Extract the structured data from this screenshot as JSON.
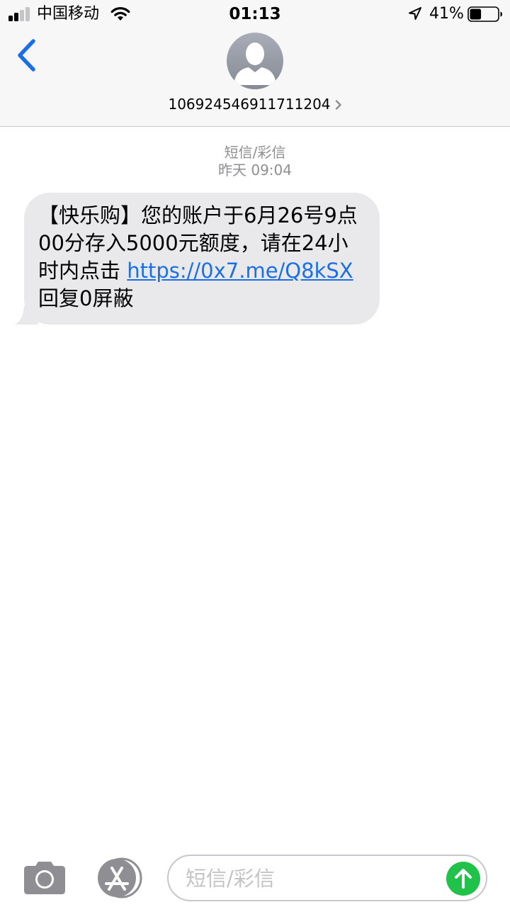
{
  "status_bar": {
    "carrier": "中国移动",
    "time": "01:13",
    "battery_percent": "41%",
    "battery_level": 0.41,
    "signal_bars_filled": 2,
    "signal_bars_total": 4,
    "icons": [
      "signal-icon",
      "wifi-icon",
      "location-arrow-icon",
      "battery-icon"
    ]
  },
  "header": {
    "back_icon": "chevron-left-icon",
    "avatar_icon": "person-silhouette-icon",
    "contact_number": "106924546911711204",
    "contact_chevron": "chevron-right-icon"
  },
  "conversation": {
    "service_label": "短信/彩信",
    "timestamp": "昨天 09:04",
    "message": {
      "text_before_link": "【快乐购】您的账户于6月26号9点00分存入5000元额度，请在24小时内点击 ",
      "link_text": "https://0x7.me/Q8kSX",
      "text_after_link": " 回复0屏蔽"
    }
  },
  "input_bar": {
    "camera_icon": "camera-icon",
    "appstore_icon": "app-store-icon",
    "placeholder": "短信/彩信",
    "send_icon": "send-arrow-up-icon"
  },
  "colors": {
    "accent_blue": "#1a6fe8",
    "send_green": "#20c24a",
    "bubble_gray": "#e9e9eb",
    "header_bg": "#f7f7f7",
    "meta_gray": "#8e8e93"
  }
}
